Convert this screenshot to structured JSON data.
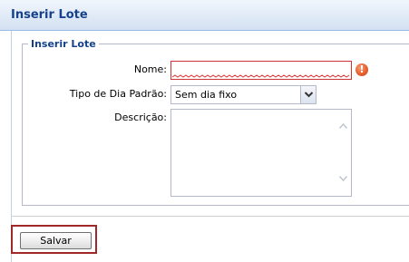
{
  "window": {
    "title": "Inserir Lote"
  },
  "form": {
    "section_title": "Inserir Lote",
    "name_label": "Nome:",
    "name_value": "",
    "day_type_label": "Tipo de Dia Padrão:",
    "day_type_selected": "Sem dia fixo",
    "description_label": "Descrição:",
    "description_value": ""
  },
  "actions": {
    "save_label": "Salvar"
  },
  "icons": {
    "error": "exclamation-circle-icon",
    "dropdown": "chevron-down-icon",
    "scroll_up": "chevron-up-icon",
    "scroll_down": "chevron-down-icon"
  },
  "colors": {
    "title": "#15428b",
    "error_border": "#cc3333",
    "error_icon": "#e46030",
    "highlight_frame": "#a02828"
  }
}
